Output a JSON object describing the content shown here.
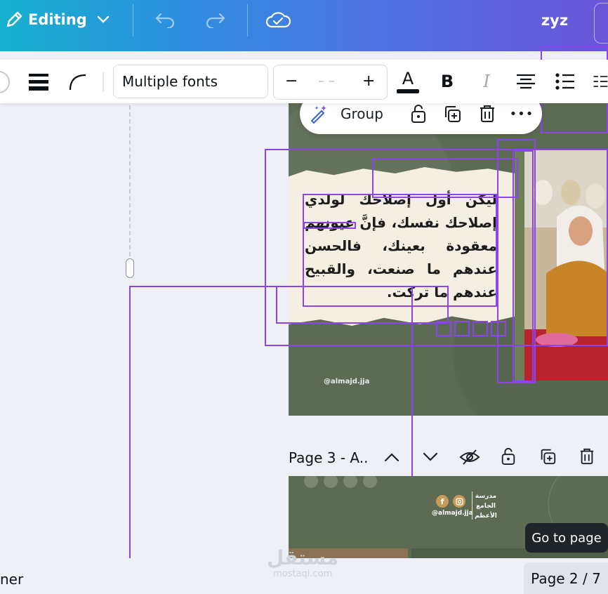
{
  "topbar": {
    "editing_label": "Editing",
    "user_label": "zyz"
  },
  "toolbar": {
    "font_name": "Multiple fonts",
    "minus": "−",
    "size_placeholder": "– –",
    "plus": "+",
    "bold": "B",
    "italic": "I",
    "text_color_glyph": "A"
  },
  "element_toolbar": {
    "group_label": "Group",
    "more_label": "•••"
  },
  "design": {
    "arabic_text": "ليكن أول إصلاحك لولدي إصلاحك نفسك، فإنَّ عيونهم معقودة بعينك، فالحسن عندهم ما صنعت، والقبيح عندهم ما تركت.",
    "handle": "@almajd.jja"
  },
  "page3": {
    "label": "Page 3 - A..",
    "school_line1": "مدرسة",
    "school_line2": "الجامع",
    "school_line3": "الأعظم",
    "handle": "@almajd.jja"
  },
  "tooltip": {
    "label": "Go to page"
  },
  "bottom": {
    "left_text": "ner",
    "page_indicator": "Page 2 / 7",
    "watermark_ar": "مستقل",
    "watermark_en": "mostaql.com"
  },
  "colors": {
    "selection": "#8a45f0",
    "topbar_start": "#16b0cf",
    "topbar_end": "#6a55d8",
    "canvas_green": "#5d6b54"
  }
}
